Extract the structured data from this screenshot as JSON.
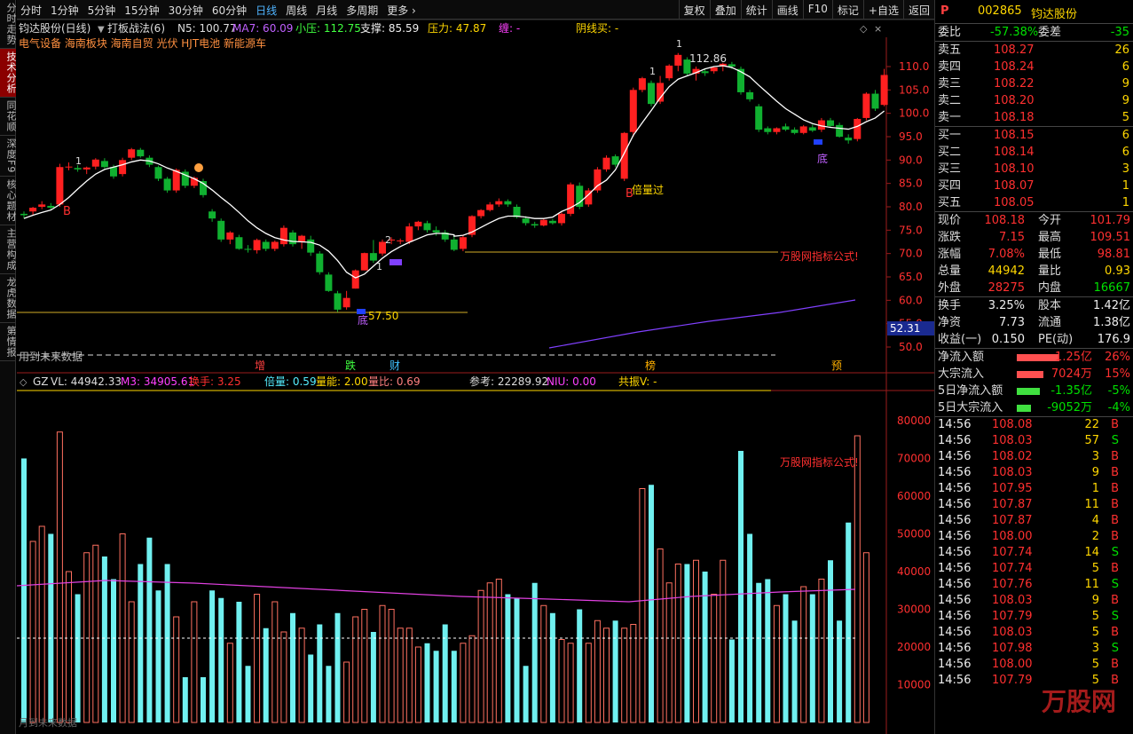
{
  "left_tabs": [
    {
      "name": "tab-timeshare",
      "label": "分时走势",
      "active": false
    },
    {
      "name": "tab-technical",
      "label": "技术分析",
      "active": true
    },
    {
      "name": "tab-tonghuashun",
      "label": "同花顺",
      "active": false
    },
    {
      "name": "tab-depth",
      "label": "深度F9",
      "active": false
    },
    {
      "name": "tab-core",
      "label": "核心题材",
      "active": false
    },
    {
      "name": "tab-business",
      "label": "主营构成",
      "active": false
    },
    {
      "name": "tab-dragon",
      "label": "龙虎数据",
      "active": false
    },
    {
      "name": "tab-info",
      "label": "第情报",
      "active": false
    }
  ],
  "periods": [
    {
      "label": "分时",
      "active": false
    },
    {
      "label": "1分钟",
      "active": false
    },
    {
      "label": "5分钟",
      "active": false
    },
    {
      "label": "15分钟",
      "active": false
    },
    {
      "label": "30分钟",
      "active": false
    },
    {
      "label": "60分钟",
      "active": false
    },
    {
      "label": "日线",
      "active": true
    },
    {
      "label": "周线",
      "active": false
    },
    {
      "label": "月线",
      "active": false
    },
    {
      "label": "多周期",
      "active": false
    },
    {
      "label": "更多 ›",
      "active": false
    }
  ],
  "tools": [
    "复权",
    "叠加",
    "统计",
    "画线",
    "F10",
    "标记",
    "+自选",
    "返回"
  ],
  "main_chart": {
    "title": "钧达股份(日线)",
    "indicator_name": "打板战法(6)",
    "n5": "N5: 100.77",
    "ma7": "MA7: 60.09",
    "xiaoya": "小压: 112.75",
    "zhicheng": "支撑: 85.59",
    "yali": "压力: 47.87",
    "chan": "缠: -",
    "yinxian": "阴线买: -",
    "concepts": "电气设备 海南板块 海南自贸 光伏 HJT电池 新能源车",
    "watermark": "万股网指标公式!",
    "future_note": "用到未来数据",
    "price_axis": [
      "110.0",
      "105.0",
      "100.0",
      "95.0",
      "90.0",
      "85.0",
      "80.0",
      "75.0",
      "70.0",
      "65.0",
      "60.0",
      "55.0",
      "50.0"
    ],
    "current_box": "52.31",
    "high_label": "112.86",
    "low_label": "57.50",
    "labels": {
      "b1": "B",
      "b2": "B",
      "bottom1": "底",
      "bottom2": "底",
      "beiliang": "倍量过",
      "one": "1",
      "two": "2"
    },
    "event_markers": [
      {
        "text": "增",
        "color": "#ff4040"
      },
      {
        "text": "跌",
        "color": "#40ff40"
      },
      {
        "text": "财",
        "color": "#40c0ff"
      },
      {
        "text": "榜",
        "color": "#ffb000"
      },
      {
        "text": "预",
        "color": "#ffb000"
      }
    ]
  },
  "volume_chart": {
    "gz": "GZ",
    "vl": "VL: 44942.33",
    "m3": "M3: 34905.61",
    "huanshou": "换手: 3.25",
    "beiliang": "倍量: 0.59",
    "liangneng": "量能: 2.00",
    "liangbi": "量比: 0.69",
    "cankao": "参考: 22289.92",
    "niu": "NIU: 0.00",
    "gongzhen": "共振V: -",
    "watermark": "万股网指标公式!",
    "axis": [
      "80000",
      "70000",
      "60000",
      "50000",
      "40000",
      "30000",
      "20000",
      "10000"
    ],
    "footer": "月到未来数据"
  },
  "quote": {
    "tag": "P",
    "code": "002865",
    "name": "钧达股份",
    "weibi_label": "委比",
    "weibi": "-57.38%",
    "weicha_label": "委差",
    "weicha": "-35",
    "asks": [
      {
        "label": "卖五",
        "price": "108.27",
        "vol": "26"
      },
      {
        "label": "卖四",
        "price": "108.24",
        "vol": "6"
      },
      {
        "label": "卖三",
        "price": "108.22",
        "vol": "9"
      },
      {
        "label": "卖二",
        "price": "108.20",
        "vol": "9"
      },
      {
        "label": "卖一",
        "price": "108.18",
        "vol": "5"
      }
    ],
    "bids": [
      {
        "label": "买一",
        "price": "108.15",
        "vol": "6"
      },
      {
        "label": "买二",
        "price": "108.14",
        "vol": "6"
      },
      {
        "label": "买三",
        "price": "108.10",
        "vol": "3"
      },
      {
        "label": "买四",
        "price": "108.07",
        "vol": "1"
      },
      {
        "label": "买五",
        "price": "108.05",
        "vol": "1"
      }
    ],
    "stats": [
      {
        "l1": "现价",
        "v1": "108.18",
        "c1": "red",
        "l2": "今开",
        "v2": "101.79",
        "c2": "red"
      },
      {
        "l1": "涨跌",
        "v1": "7.15",
        "c1": "red",
        "l2": "最高",
        "v2": "109.51",
        "c2": "red"
      },
      {
        "l1": "涨幅",
        "v1": "7.08%",
        "c1": "red",
        "l2": "最低",
        "v2": "98.81",
        "c2": "red"
      },
      {
        "l1": "总量",
        "v1": "44942",
        "c1": "yellow",
        "l2": "量比",
        "v2": "0.93",
        "c2": "yellow"
      },
      {
        "l1": "外盘",
        "v1": "28275",
        "c1": "red",
        "l2": "内盘",
        "v2": "16667",
        "c2": "green"
      }
    ],
    "stats2": [
      {
        "l1": "换手",
        "v1": "3.25%",
        "c1": "white",
        "l2": "股本",
        "v2": "1.42亿",
        "c2": "white"
      },
      {
        "l1": "净资",
        "v1": "7.73",
        "c1": "white",
        "l2": "流通",
        "v2": "1.38亿",
        "c2": "white"
      },
      {
        "l1": "收益(一)",
        "v1": "0.150",
        "c1": "white",
        "l2": "PE(动)",
        "v2": "176.9",
        "c2": "white"
      }
    ],
    "flows": [
      {
        "label": "净流入额",
        "value": "1.25亿",
        "pct": "26%",
        "color": "red",
        "bar": 48
      },
      {
        "label": "大宗流入",
        "value": "7024万",
        "pct": "15%",
        "color": "red",
        "bar": 30
      },
      {
        "label": "5日净流入额",
        "value": "-1.35亿",
        "pct": "-5%",
        "color": "green",
        "bar": 26
      },
      {
        "label": "5日大宗流入",
        "value": "-9052万",
        "pct": "-4%",
        "color": "green",
        "bar": 16
      }
    ],
    "ticks": [
      {
        "t": "14:56",
        "p": "108.08",
        "v": "22",
        "s": "B"
      },
      {
        "t": "14:56",
        "p": "108.03",
        "v": "57",
        "s": "S"
      },
      {
        "t": "14:56",
        "p": "108.02",
        "v": "3",
        "s": "B"
      },
      {
        "t": "14:56",
        "p": "108.03",
        "v": "9",
        "s": "B"
      },
      {
        "t": "14:56",
        "p": "107.95",
        "v": "1",
        "s": "B"
      },
      {
        "t": "14:56",
        "p": "107.87",
        "v": "11",
        "s": "B"
      },
      {
        "t": "14:56",
        "p": "107.87",
        "v": "4",
        "s": "B"
      },
      {
        "t": "14:56",
        "p": "108.00",
        "v": "2",
        "s": "B"
      },
      {
        "t": "14:56",
        "p": "107.74",
        "v": "14",
        "s": "S"
      },
      {
        "t": "14:56",
        "p": "107.74",
        "v": "5",
        "s": "B"
      },
      {
        "t": "14:56",
        "p": "107.76",
        "v": "11",
        "s": "S"
      },
      {
        "t": "14:56",
        "p": "108.03",
        "v": "9",
        "s": "B"
      },
      {
        "t": "14:56",
        "p": "107.79",
        "v": "5",
        "s": "S"
      },
      {
        "t": "14:56",
        "p": "108.03",
        "v": "5",
        "s": "B"
      },
      {
        "t": "14:56",
        "p": "107.98",
        "v": "3",
        "s": "S"
      },
      {
        "t": "14:56",
        "p": "108.00",
        "v": "5",
        "s": "B"
      },
      {
        "t": "14:56",
        "p": "107.79",
        "v": "5",
        "s": "B"
      }
    ],
    "site_watermark": "万股网"
  },
  "candles": [
    {
      "o": 78.5,
      "h": 79.0,
      "l": 77.5,
      "c": 78.2
    },
    {
      "o": 79.0,
      "h": 80.0,
      "l": 78.2,
      "c": 79.8
    },
    {
      "o": 80.0,
      "h": 81.2,
      "l": 79.5,
      "c": 80.5
    },
    {
      "o": 80.2,
      "h": 80.8,
      "l": 79.4,
      "c": 79.8
    },
    {
      "o": 80.5,
      "h": 89.2,
      "l": 80.0,
      "c": 88.5
    },
    {
      "o": 88.5,
      "h": 89.5,
      "l": 87.8,
      "c": 88.6
    },
    {
      "o": 88.3,
      "h": 88.9,
      "l": 87.5,
      "c": 88.0
    },
    {
      "o": 88.0,
      "h": 88.6,
      "l": 87.0,
      "c": 88.4
    },
    {
      "o": 88.6,
      "h": 90.4,
      "l": 88.0,
      "c": 90.1
    },
    {
      "o": 89.8,
      "h": 90.4,
      "l": 88.2,
      "c": 88.5
    },
    {
      "o": 88.5,
      "h": 89.0,
      "l": 86.0,
      "c": 86.5
    },
    {
      "o": 87.0,
      "h": 90.5,
      "l": 86.5,
      "c": 90.0
    },
    {
      "o": 90.5,
      "h": 92.6,
      "l": 90.0,
      "c": 92.3
    },
    {
      "o": 92.2,
      "h": 92.6,
      "l": 90.5,
      "c": 90.8
    },
    {
      "o": 90.5,
      "h": 91.0,
      "l": 88.5,
      "c": 89.0
    },
    {
      "o": 88.5,
      "h": 88.8,
      "l": 85.5,
      "c": 86.0
    },
    {
      "o": 86.0,
      "h": 86.4,
      "l": 83.0,
      "c": 83.5
    },
    {
      "o": 83.5,
      "h": 88.2,
      "l": 83.0,
      "c": 87.9
    },
    {
      "o": 87.5,
      "h": 88.0,
      "l": 84.0,
      "c": 84.5
    },
    {
      "o": 84.5,
      "h": 86.5,
      "l": 84.0,
      "c": 86.2
    },
    {
      "o": 85.5,
      "h": 86.0,
      "l": 82.0,
      "c": 82.5
    },
    {
      "o": 79.0,
      "h": 79.5,
      "l": 76.8,
      "c": 77.5
    },
    {
      "o": 77.0,
      "h": 77.5,
      "l": 72.5,
      "c": 73.0
    },
    {
      "o": 73.0,
      "h": 74.8,
      "l": 72.0,
      "c": 74.5
    },
    {
      "o": 73.5,
      "h": 74.0,
      "l": 70.8,
      "c": 71.0
    },
    {
      "o": 71.0,
      "h": 71.8,
      "l": 70.2,
      "c": 70.8
    },
    {
      "o": 70.7,
      "h": 73.2,
      "l": 70.0,
      "c": 72.9
    },
    {
      "o": 72.5,
      "h": 73.0,
      "l": 70.5,
      "c": 71.0
    },
    {
      "o": 71.0,
      "h": 72.8,
      "l": 70.5,
      "c": 72.5
    },
    {
      "o": 72.0,
      "h": 76.0,
      "l": 71.5,
      "c": 75.5
    },
    {
      "o": 74.5,
      "h": 75.0,
      "l": 71.5,
      "c": 72.0
    },
    {
      "o": 72.5,
      "h": 74.0,
      "l": 71.0,
      "c": 73.8
    },
    {
      "o": 73.0,
      "h": 73.8,
      "l": 69.5,
      "c": 70.2
    },
    {
      "o": 70.0,
      "h": 70.5,
      "l": 65.5,
      "c": 66.0
    },
    {
      "o": 65.5,
      "h": 66.0,
      "l": 61.8,
      "c": 62.0
    },
    {
      "o": 61.5,
      "h": 62.0,
      "l": 57.5,
      "c": 58.0
    },
    {
      "o": 58.5,
      "h": 62.0,
      "l": 58.0,
      "c": 60.5
    },
    {
      "o": 62.5,
      "h": 66.6,
      "l": 62.5,
      "c": 66.4
    },
    {
      "o": 66.4,
      "h": 70.2,
      "l": 66.4,
      "c": 70.1
    },
    {
      "o": 70.1,
      "h": 72.9,
      "l": 68.0,
      "c": 68.5
    },
    {
      "o": 70.0,
      "h": 73.0,
      "l": 69.5,
      "c": 72.5
    },
    {
      "o": 72.8,
      "h": 73.5,
      "l": 72.0,
      "c": 73.0
    },
    {
      "o": 72.8,
      "h": 73.2,
      "l": 72.0,
      "c": 72.8
    },
    {
      "o": 72.5,
      "h": 76.5,
      "l": 72.0,
      "c": 75.8
    },
    {
      "o": 75.8,
      "h": 77.0,
      "l": 75.0,
      "c": 76.8
    },
    {
      "o": 76.5,
      "h": 77.0,
      "l": 74.5,
      "c": 75.0
    },
    {
      "o": 75.0,
      "h": 75.8,
      "l": 73.8,
      "c": 74.5
    },
    {
      "o": 74.5,
      "h": 75.0,
      "l": 72.5,
      "c": 73.0
    },
    {
      "o": 73.0,
      "h": 73.8,
      "l": 70.5,
      "c": 70.8
    },
    {
      "o": 71.0,
      "h": 74.0,
      "l": 70.5,
      "c": 73.5
    },
    {
      "o": 74.0,
      "h": 78.2,
      "l": 73.5,
      "c": 78.0
    },
    {
      "o": 78.0,
      "h": 79.5,
      "l": 77.5,
      "c": 79.3
    },
    {
      "o": 79.3,
      "h": 81.0,
      "l": 79.0,
      "c": 80.5
    },
    {
      "o": 80.5,
      "h": 81.8,
      "l": 80.0,
      "c": 81.2
    },
    {
      "o": 81.2,
      "h": 81.6,
      "l": 80.0,
      "c": 80.5
    },
    {
      "o": 80.0,
      "h": 80.5,
      "l": 77.5,
      "c": 77.8
    },
    {
      "o": 77.5,
      "h": 78.0,
      "l": 76.0,
      "c": 76.5
    },
    {
      "o": 76.3,
      "h": 76.8,
      "l": 75.5,
      "c": 76.0
    },
    {
      "o": 76.0,
      "h": 77.5,
      "l": 75.8,
      "c": 77.2
    },
    {
      "o": 77.0,
      "h": 77.4,
      "l": 76.2,
      "c": 76.5
    },
    {
      "o": 76.5,
      "h": 78.8,
      "l": 76.0,
      "c": 78.5
    },
    {
      "o": 78.5,
      "h": 85.2,
      "l": 78.0,
      "c": 84.8
    },
    {
      "o": 84.5,
      "h": 85.2,
      "l": 79.5,
      "c": 80.0
    },
    {
      "o": 80.5,
      "h": 84.0,
      "l": 80.0,
      "c": 83.5
    },
    {
      "o": 83.5,
      "h": 88.5,
      "l": 83.0,
      "c": 88.0
    },
    {
      "o": 88.0,
      "h": 91.0,
      "l": 87.5,
      "c": 90.5
    },
    {
      "o": 90.8,
      "h": 91.2,
      "l": 88.5,
      "c": 89.0
    },
    {
      "o": 86.0,
      "h": 96.0,
      "l": 85.5,
      "c": 95.8
    },
    {
      "o": 96.0,
      "h": 105.5,
      "l": 95.0,
      "c": 105.0
    },
    {
      "o": 105.0,
      "h": 107.8,
      "l": 104.5,
      "c": 107.5
    },
    {
      "o": 106.5,
      "h": 107.0,
      "l": 101.5,
      "c": 102.0
    },
    {
      "o": 102.5,
      "h": 108.0,
      "l": 102.0,
      "c": 106.5
    },
    {
      "o": 107.5,
      "h": 110.5,
      "l": 107.0,
      "c": 110.2
    },
    {
      "o": 110.2,
      "h": 112.9,
      "l": 109.0,
      "c": 112.5
    },
    {
      "o": 111.5,
      "h": 112.0,
      "l": 108.0,
      "c": 108.5
    },
    {
      "o": 108.5,
      "h": 110.0,
      "l": 107.0,
      "c": 109.5
    },
    {
      "o": 109.0,
      "h": 109.6,
      "l": 108.0,
      "c": 108.6
    },
    {
      "o": 109.0,
      "h": 110.0,
      "l": 108.5,
      "c": 109.8
    },
    {
      "o": 110.0,
      "h": 110.8,
      "l": 109.0,
      "c": 110.6
    },
    {
      "o": 110.5,
      "h": 111.0,
      "l": 109.5,
      "c": 110.0
    },
    {
      "o": 109.5,
      "h": 110.0,
      "l": 104.0,
      "c": 104.5
    },
    {
      "o": 104.5,
      "h": 105.0,
      "l": 102.5,
      "c": 103.0
    },
    {
      "o": 101.5,
      "h": 102.0,
      "l": 96.0,
      "c": 96.5
    },
    {
      "o": 96.8,
      "h": 97.2,
      "l": 95.5,
      "c": 96.0
    },
    {
      "o": 96.0,
      "h": 97.0,
      "l": 95.5,
      "c": 96.8
    },
    {
      "o": 97.2,
      "h": 97.8,
      "l": 96.2,
      "c": 96.5
    },
    {
      "o": 96.5,
      "h": 97.0,
      "l": 95.5,
      "c": 95.8
    },
    {
      "o": 95.8,
      "h": 97.5,
      "l": 95.5,
      "c": 97.2
    },
    {
      "o": 97.0,
      "h": 97.6,
      "l": 96.0,
      "c": 96.3
    },
    {
      "o": 96.5,
      "h": 99.0,
      "l": 96.0,
      "c": 98.5
    },
    {
      "o": 98.5,
      "h": 99.0,
      "l": 97.0,
      "c": 97.3
    },
    {
      "o": 97.5,
      "h": 98.0,
      "l": 94.8,
      "c": 95.0
    },
    {
      "o": 94.8,
      "h": 95.5,
      "l": 93.5,
      "c": 94.2
    },
    {
      "o": 94.5,
      "h": 99.0,
      "l": 94.0,
      "c": 98.8
    },
    {
      "o": 99.0,
      "h": 104.5,
      "l": 98.5,
      "c": 104.2
    },
    {
      "o": 104.2,
      "h": 105.0,
      "l": 100.5,
      "c": 101.0
    },
    {
      "o": 101.8,
      "h": 109.5,
      "l": 101.5,
      "c": 108.2
    }
  ],
  "volumes": [
    70000,
    48000,
    52000,
    50000,
    77000,
    40000,
    34000,
    45000,
    47000,
    44000,
    38000,
    50000,
    32000,
    42000,
    49000,
    35000,
    42000,
    28000,
    12000,
    32000,
    12000,
    35000,
    33000,
    21000,
    32000,
    15000,
    34000,
    25000,
    32000,
    24000,
    29000,
    25000,
    18000,
    26000,
    15000,
    29000,
    16000,
    28000,
    30000,
    24000,
    31000,
    30000,
    25000,
    25000,
    20000,
    21000,
    19000,
    26000,
    19000,
    21000,
    23000,
    35000,
    37000,
    38000,
    34000,
    33000,
    15000,
    37000,
    31000,
    29000,
    22000,
    21000,
    30000,
    21000,
    27000,
    25000,
    27000,
    25000,
    26000,
    62000,
    63000,
    46000,
    37000,
    42000,
    42000,
    43000,
    40000,
    34000,
    43000,
    22000,
    72000,
    50000,
    37000,
    38000,
    31000,
    34000,
    27000,
    36000,
    34000,
    38000,
    43000,
    27000,
    53000,
    76000,
    45000
  ],
  "ma_line": [
    77.5,
    78.2,
    78.8,
    79.3,
    80.5,
    82.0,
    83.8,
    85.5,
    87.0,
    88.0,
    88.5,
    89.0,
    89.6,
    90.0,
    89.8,
    89.2,
    88.3,
    87.6,
    86.8,
    86.0,
    85.0,
    83.6,
    82.0,
    80.5,
    78.8,
    77.0,
    75.5,
    74.3,
    73.4,
    72.9,
    72.6,
    72.5,
    72.4,
    71.8,
    70.5,
    68.5,
    66.0,
    64.8,
    65.6,
    67.3,
    69.0,
    70.4,
    71.5,
    72.4,
    73.2,
    74.0,
    74.3,
    74.3,
    74.0,
    73.7,
    73.9,
    74.6,
    75.6,
    76.6,
    77.5,
    78.0,
    78.0,
    77.8,
    77.5,
    77.5,
    77.8,
    79.0,
    79.8,
    80.9,
    82.6,
    84.5,
    85.7,
    87.9,
    91.5,
    95.3,
    98.0,
    100.6,
    103.3,
    105.7,
    107.3,
    108.0,
    108.7,
    109.5,
    110.0,
    110.2,
    109.8,
    108.9,
    107.8,
    106.0,
    104.3,
    102.6,
    101.0,
    99.8,
    98.6,
    97.8,
    97.3,
    97.0,
    96.8,
    96.6,
    97.2,
    98.2,
    99.0,
    100.5
  ]
}
